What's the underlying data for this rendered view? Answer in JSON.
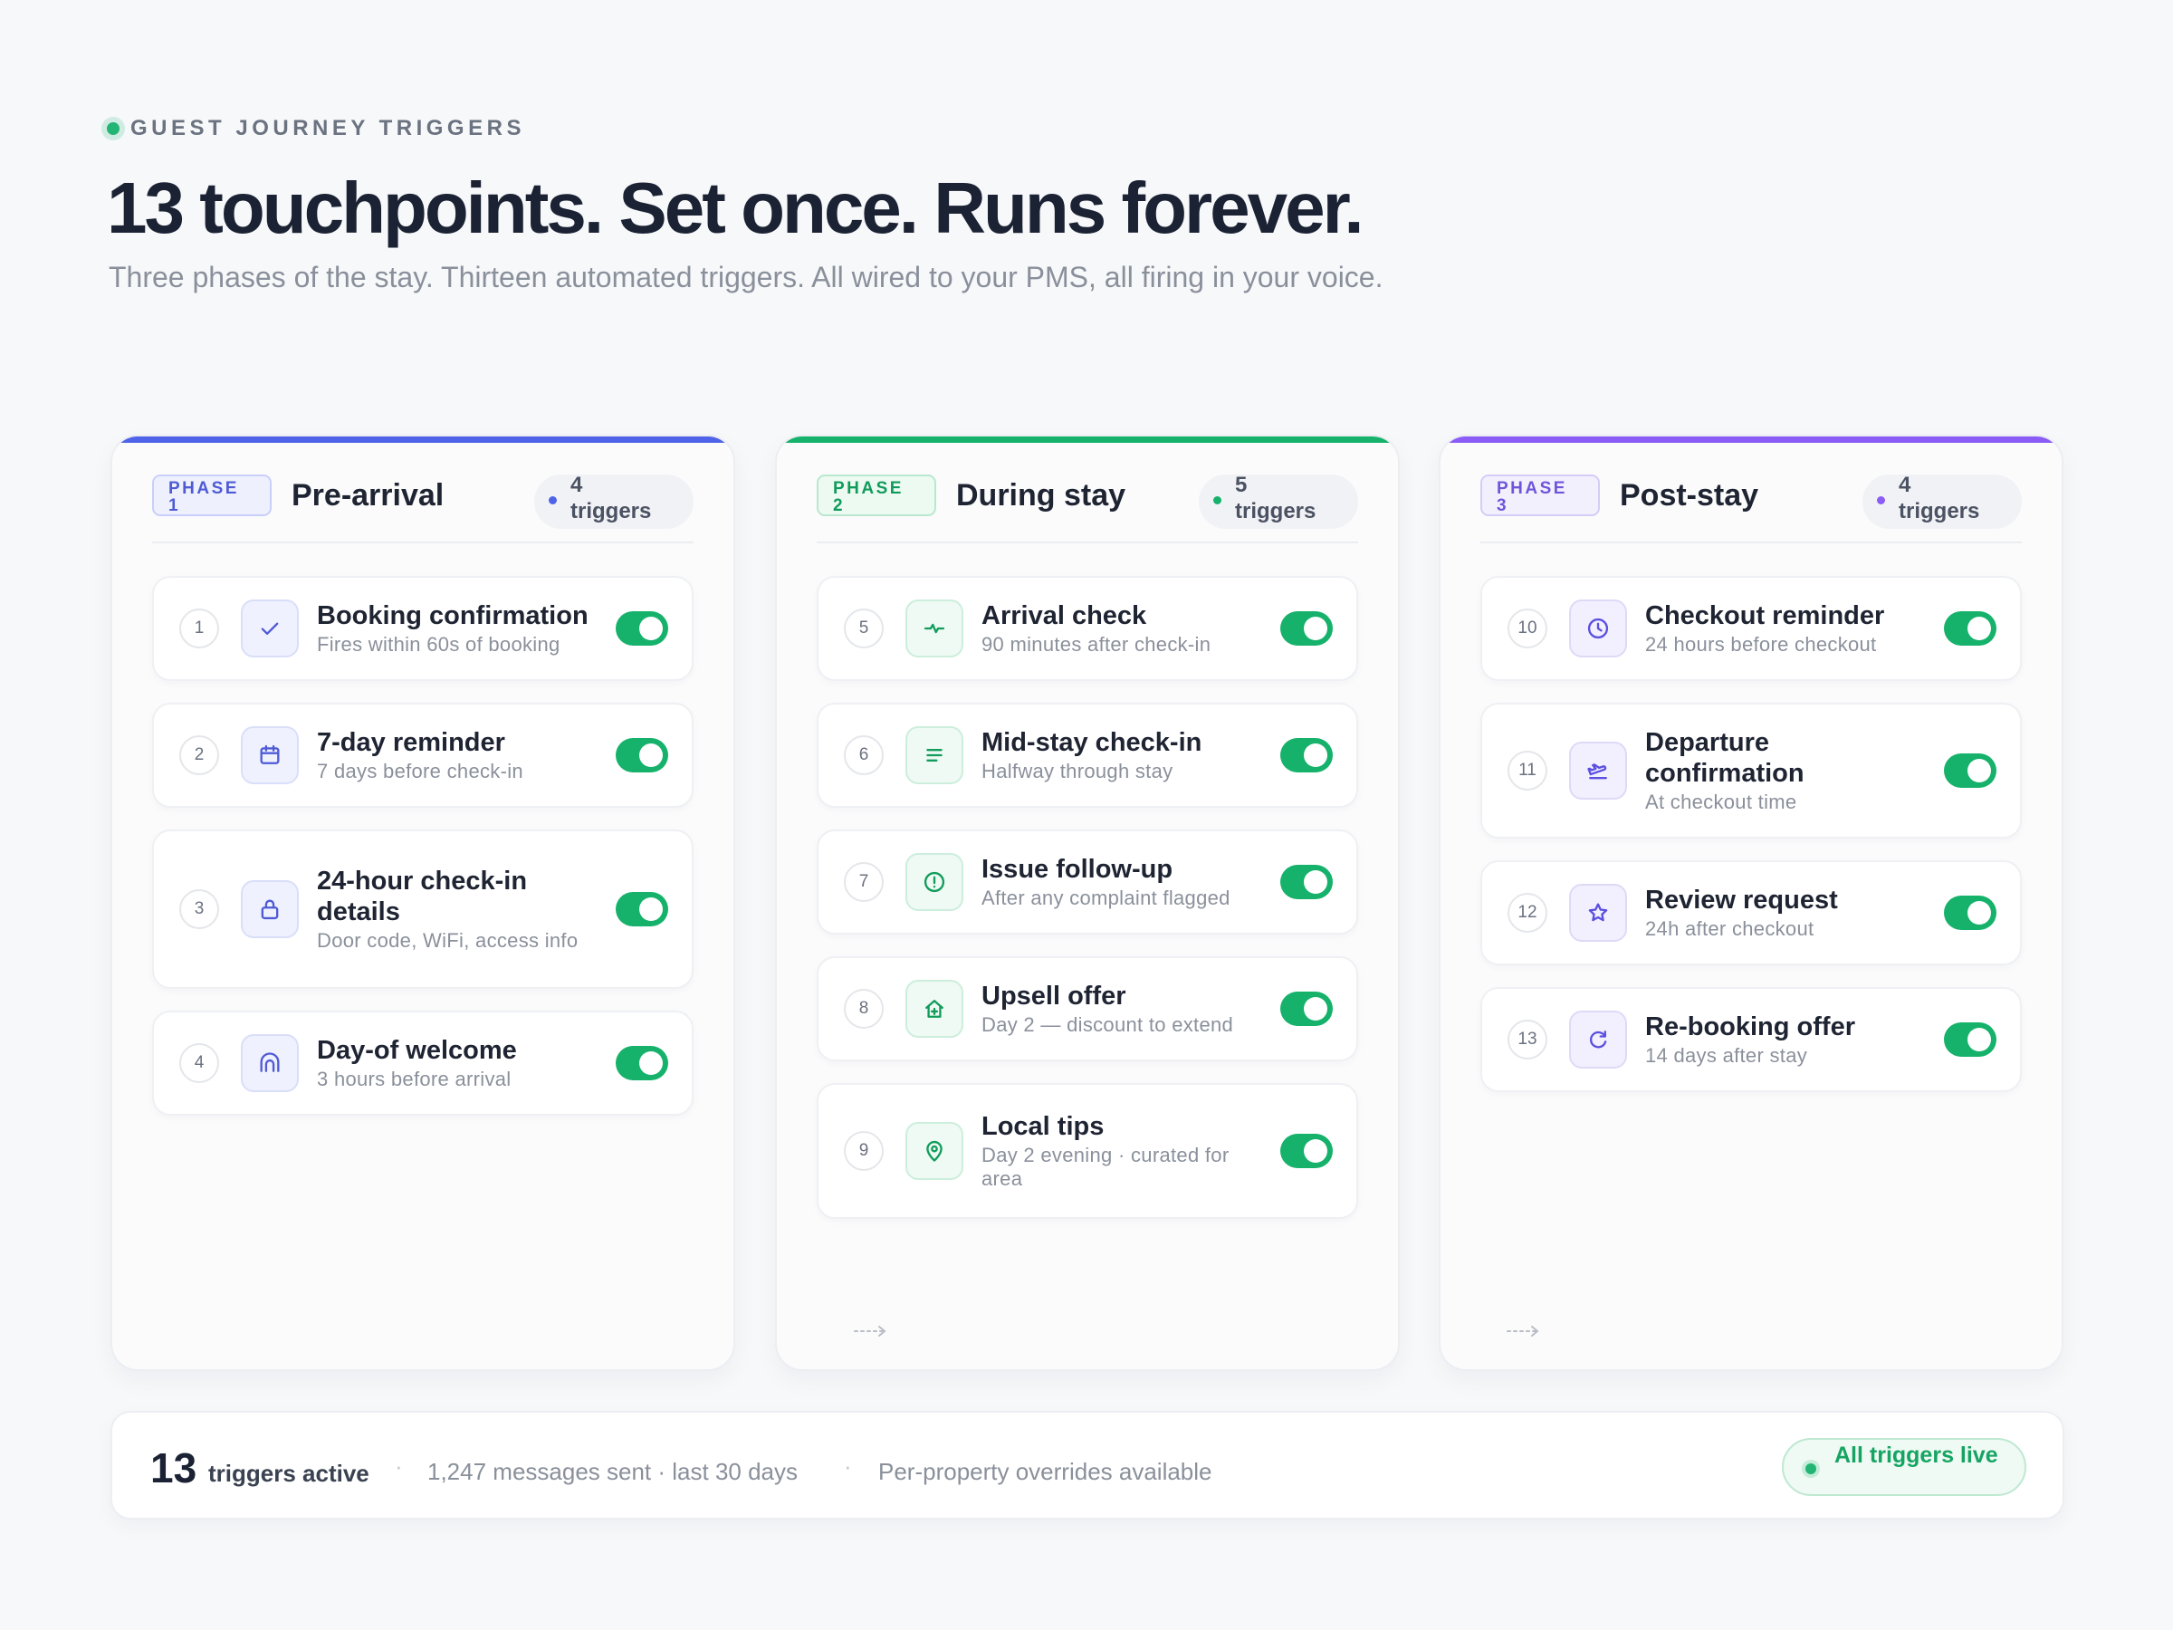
{
  "header": {
    "eyebrow": "GUEST JOURNEY TRIGGERS",
    "title": "13 touchpoints. Set once. Runs forever.",
    "subtitle": "Three phases of the stay. Thirteen automated triggers. All wired to your PMS, all firing in your voice."
  },
  "colors": {
    "phase_1": "#4f63e8",
    "phase_2": "#16b26b",
    "phase_3": "#8b5cf6",
    "toggle_on": "#16b26b"
  },
  "phases": [
    {
      "badge_label": "PHASE",
      "badge_number": "1",
      "name": "Pre-arrival",
      "trigger_count": "4",
      "trigger_word": "triggers",
      "triggers": [
        {
          "index": "1",
          "icon": "check-icon",
          "title": "Booking confirmation",
          "subtitle": "Fires within 60s of booking",
          "enabled": true
        },
        {
          "index": "2",
          "icon": "calendar-icon",
          "title": "7-day reminder",
          "subtitle": "7 days before check-in",
          "enabled": true
        },
        {
          "index": "3",
          "icon": "lock-icon",
          "title": "24-hour check-in details",
          "subtitle": "Door code, WiFi, access info",
          "enabled": true
        },
        {
          "index": "4",
          "icon": "door-icon",
          "title": "Day-of welcome",
          "subtitle": "3 hours before arrival",
          "enabled": true
        }
      ]
    },
    {
      "badge_label": "PHASE",
      "badge_number": "2",
      "name": "During stay",
      "trigger_count": "5",
      "trigger_word": "triggers",
      "triggers": [
        {
          "index": "5",
          "icon": "pulse-icon",
          "title": "Arrival check",
          "subtitle": "90 minutes after check-in",
          "enabled": true
        },
        {
          "index": "6",
          "icon": "lines-icon",
          "title": "Mid-stay check-in",
          "subtitle": "Halfway through stay",
          "enabled": true
        },
        {
          "index": "7",
          "icon": "alert-circle-icon",
          "title": "Issue follow-up",
          "subtitle": "After any complaint flagged",
          "enabled": true
        },
        {
          "index": "8",
          "icon": "home-plus-icon",
          "title": "Upsell offer",
          "subtitle": "Day 2 — discount to extend",
          "enabled": true
        },
        {
          "index": "9",
          "icon": "map-pin-icon",
          "title": "Local tips",
          "subtitle": "Day 2 evening · curated for area",
          "enabled": true
        }
      ]
    },
    {
      "badge_label": "PHASE",
      "badge_number": "3",
      "name": "Post-stay",
      "trigger_count": "4",
      "trigger_word": "triggers",
      "triggers": [
        {
          "index": "10",
          "icon": "clock-icon",
          "title": "Checkout reminder",
          "subtitle": "24 hours before checkout",
          "enabled": true
        },
        {
          "index": "11",
          "icon": "plane-departure-icon",
          "title": "Departure confirmation",
          "subtitle": "At checkout time",
          "enabled": true
        },
        {
          "index": "12",
          "icon": "star-icon",
          "title": "Review request",
          "subtitle": "24h after checkout",
          "enabled": true
        },
        {
          "index": "13",
          "icon": "refresh-icon",
          "title": "Re-booking offer",
          "subtitle": "14 days after stay",
          "enabled": true
        }
      ]
    }
  ],
  "footer": {
    "count": "13",
    "count_label": "triggers active",
    "separator": "·",
    "messages": "1,247 messages sent · last 30 days",
    "overrides": "Per-property overrides available",
    "status": "All triggers live"
  }
}
